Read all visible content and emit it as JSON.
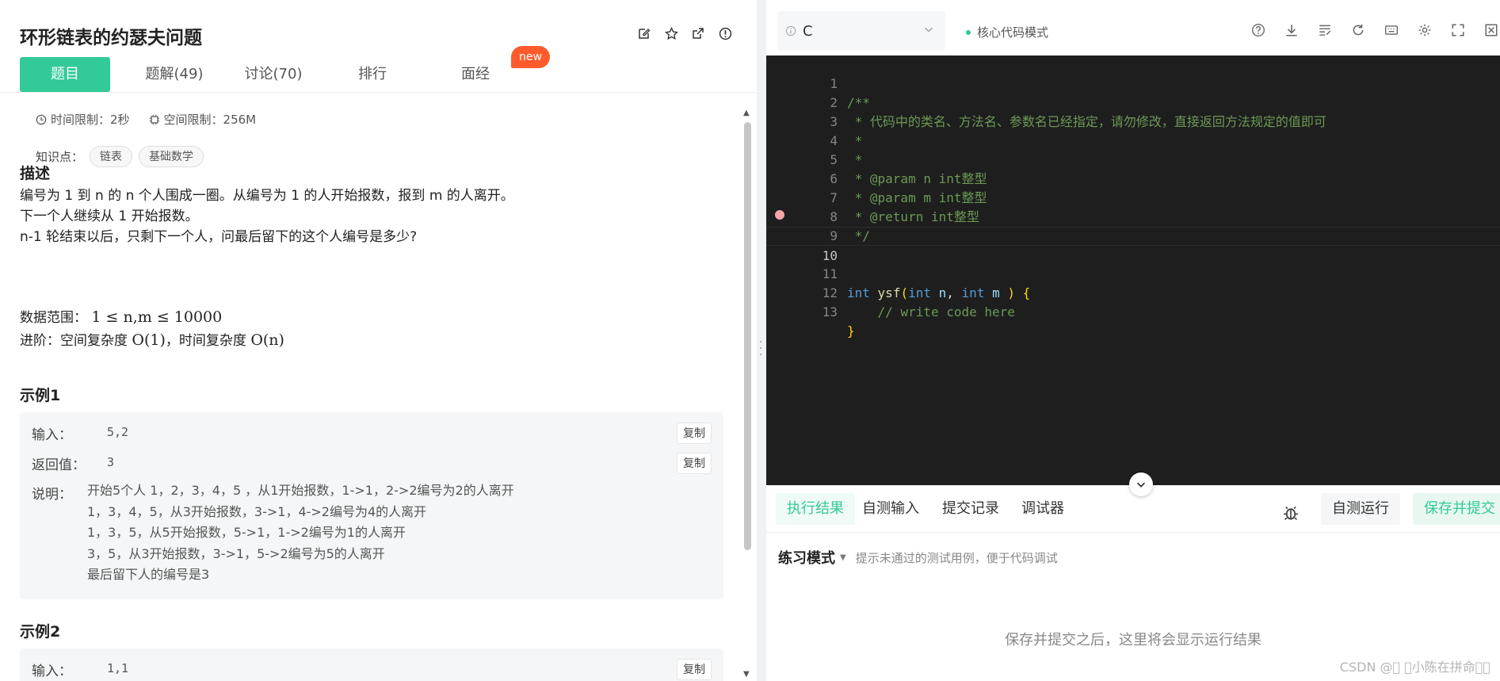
{
  "problem": {
    "title": "环形链表的约瑟夫问题",
    "tabs": [
      {
        "label": "题目"
      },
      {
        "label": "题解(49)"
      },
      {
        "label": "讨论(70)"
      },
      {
        "label": "排行"
      },
      {
        "label": "面经"
      }
    ],
    "new_badge": "new",
    "time_limit": "时间限制：2秒",
    "space_limit": "空间限制：256M",
    "knowledge_label": "知识点：",
    "tags": [
      "链表",
      "基础数学"
    ],
    "desc_heading": "描述",
    "desc_lines": [
      "编号为 1 到 n 的 n 个人围成一圈。从编号为 1 的人开始报数，报到 m 的人离开。",
      "下一个人继续从 1 开始报数。",
      "n-1 轮结束以后，只剩下一个人，问最后留下的这个人编号是多少?"
    ],
    "range_label": "数据范围：",
    "range_math": "1 ≤ n,m ≤ 10000",
    "advance_label": "进阶：空间复杂度",
    "advance_math1": "O(1)",
    "advance_sep": "，时间复杂度",
    "advance_math2": "O(n)",
    "example1": {
      "heading": "示例1",
      "input_label": "输入：",
      "input_value": "5,2",
      "return_label": "返回值：",
      "return_value": "3",
      "explain_label": "说明：",
      "explain_lines": [
        "开始5个人 1，2，3，4，5 ，从1开始报数，1->1，2->2编号为2的人离开",
        "1，3，4，5，从3开始报数，3->1，4->2编号为4的人离开",
        "1，3，5，从5开始报数，5->1，1->2编号为1的人离开",
        "3，5，从3开始报数，3->1，5->2编号为5的人离开",
        "最后留下人的编号是3"
      ],
      "copy": "复制"
    },
    "example2": {
      "heading": "示例2",
      "input_label": "输入：",
      "input_value": "1,1",
      "copy": "复制"
    }
  },
  "editor": {
    "language": "C",
    "mode": "核心代码模式",
    "lines": [
      {
        "n": "1",
        "text": "/**"
      },
      {
        "n": "2",
        "text": " * 代码中的类名、方法名、参数名已经指定，请勿修改，直接返回方法规定的值即可"
      },
      {
        "n": "3",
        "text": " *"
      },
      {
        "n": "4",
        "text": " *"
      },
      {
        "n": "5",
        "text": " * @param n int整型"
      },
      {
        "n": "6",
        "text": " * @param m int整型"
      },
      {
        "n": "7",
        "text": " * @return int整型"
      },
      {
        "n": "8",
        "text": " */"
      },
      {
        "n": "9",
        "text": ""
      },
      {
        "n": "10",
        "text": ""
      },
      {
        "n": "11",
        "text": "int ysf(int n, int m ) {"
      },
      {
        "n": "12",
        "text": "    // write code here"
      },
      {
        "n": "13",
        "text": "}"
      }
    ]
  },
  "results": {
    "tabs": [
      "执行结果",
      "自测输入",
      "提交记录",
      "调试器"
    ],
    "run_button": "自测运行",
    "submit_button": "保存并提交",
    "practice_mode": "练习模式",
    "practice_hint": "提示未通过的测试用例，便于代码调试",
    "placeholder": "保存并提交之后，这里将会显示运行结果"
  },
  "watermark": "CSDN @\u0000 \u0000小陈在拼命\u0000\u0000",
  "colors": {
    "accent": "#32ca99",
    "new_badge": "#ff5a2b",
    "editor_bg": "#1e1e1e"
  }
}
